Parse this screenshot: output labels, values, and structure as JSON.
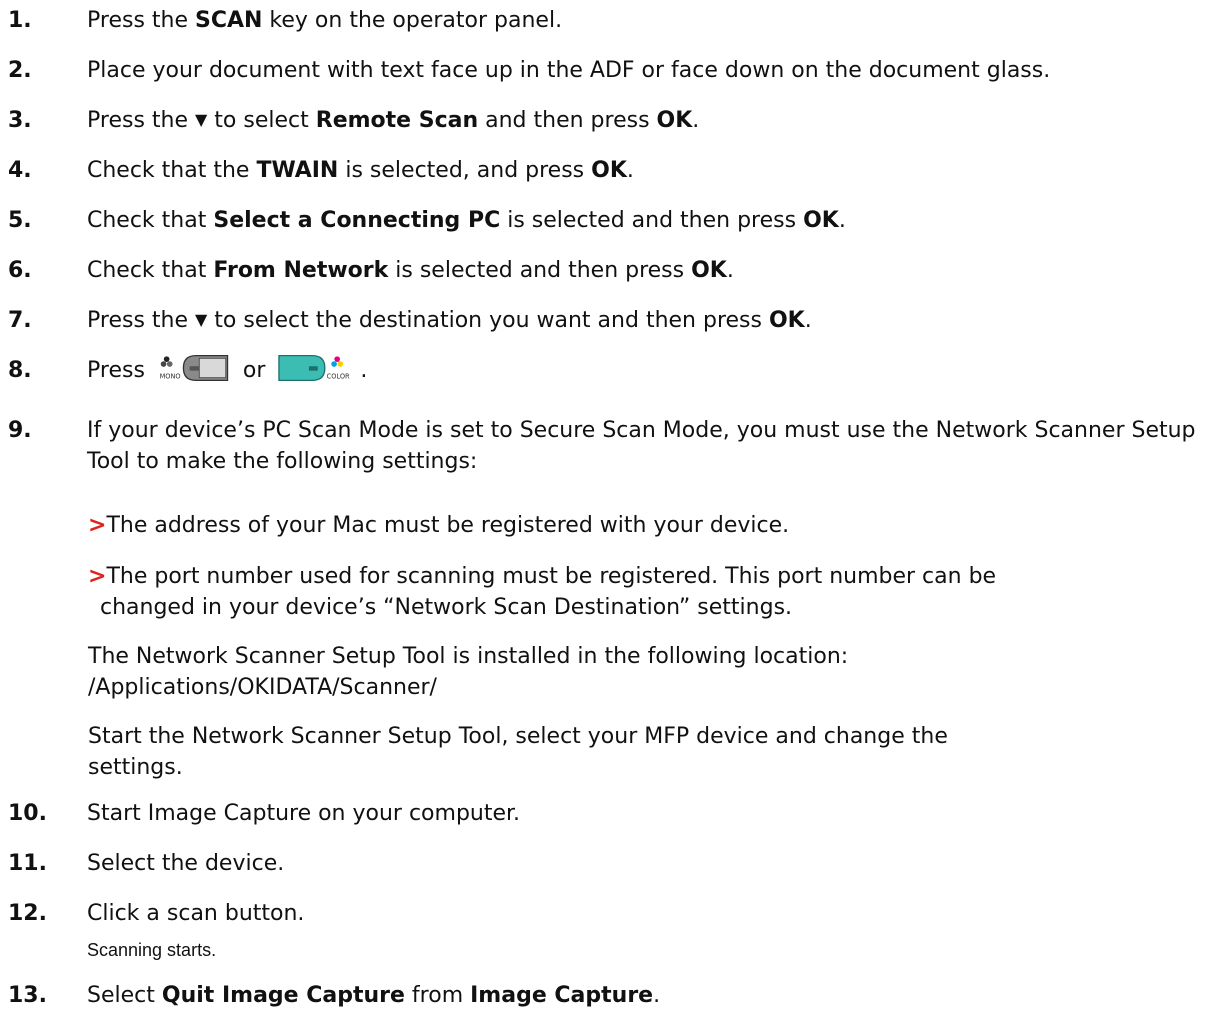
{
  "steps": [
    {
      "num": "1.",
      "a": "Press the ",
      "b1": "SCAN",
      "c": " key on the operator panel."
    },
    {
      "num": "2.",
      "a": "Place your document with text face up in the ADF or face down on the document glass."
    },
    {
      "num": "3.",
      "a": "Press the ",
      "tri": "▼",
      "c": " to select ",
      "b1": "Remote Scan",
      "d": " and then press ",
      "b2": "OK",
      "e": "."
    },
    {
      "num": "4.",
      "a": "Check that the ",
      "b1": "TWAIN",
      "c": " is selected, and press ",
      "b2": "OK",
      "e": "."
    },
    {
      "num": "5.",
      "a": "Check that ",
      "b1": "Select a Connecting PC",
      "c": " is selected and then press ",
      "b2": "OK",
      "e": "."
    },
    {
      "num": "6.",
      "a": "Check that ",
      "b1": "From Network",
      "c": " is selected and then press ",
      "b2": "OK",
      "e": "."
    },
    {
      "num": "7.",
      "a": "Press the ",
      "tri": "▼",
      "c": " to select the destination you want and then press ",
      "b2": "OK",
      "e": "."
    },
    {
      "num": "8.",
      "a": "Press ",
      "c": " or ",
      "e": ".",
      "mono_label": "MONO",
      "color_label": "COLOR"
    },
    {
      "num": "9.",
      "a": "If your device’s PC Scan Mode is set to Secure Scan Mode, you must use the Network Scanner Setup Tool to make the following settings:"
    },
    {
      "num": "10.",
      "a": "Start Image Capture on your computer."
    },
    {
      "num": "11.",
      "a": "Select the device."
    },
    {
      "num": "12.",
      "a": "Click a scan button."
    },
    {
      "num": "13.",
      "a": "Select ",
      "b1": "Quit Image Capture",
      "c": " from ",
      "b2": "Image Capture",
      "e": "."
    }
  ],
  "step9_sub": {
    "bullet_marker": ">",
    "bullet1": "The address of your Mac must be registered with your device.",
    "bullet2_line1": "The port number used for scanning must be registered. This port number can be",
    "bullet2_line2": "changed in your device’s “Network Scan Destination” settings.",
    "para1_line1": "The Network Scanner Setup Tool is installed in the following location:",
    "para1_line2": "/Applications/OKIDATA/Scanner/",
    "para2_line1": "Start the Network Scanner Setup Tool, select your MFP device and change the",
    "para2_line2": "settings."
  },
  "step12_note": "Scanning starts.",
  "colors": {
    "bullet_marker": "#e0231d",
    "mono_key": "#8a8a8a",
    "color_key": "#3cbdb4"
  },
  "icons": [
    "mono-start-key-icon",
    "color-start-key-icon",
    "down-arrow-key-icon"
  ]
}
